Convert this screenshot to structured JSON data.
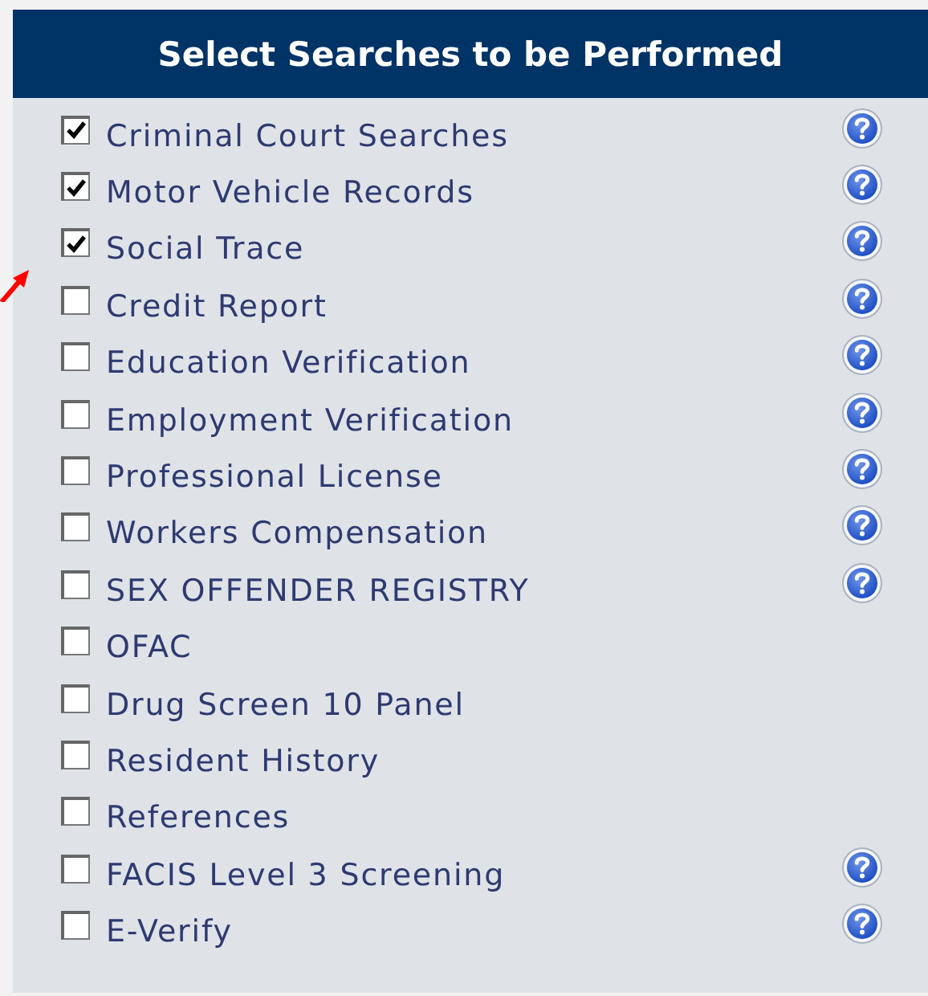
{
  "panel": {
    "title": "Select Searches to be Performed"
  },
  "searches": [
    {
      "label": "Criminal Court Searches",
      "checked": true,
      "help": true
    },
    {
      "label": "Motor Vehicle Records",
      "checked": true,
      "help": true
    },
    {
      "label": "Social Trace",
      "checked": true,
      "help": true
    },
    {
      "label": "Credit Report",
      "checked": false,
      "help": true
    },
    {
      "label": "Education Verification",
      "checked": false,
      "help": true
    },
    {
      "label": "Employment Verification",
      "checked": false,
      "help": true
    },
    {
      "label": "Professional License",
      "checked": false,
      "help": true
    },
    {
      "label": "Workers Compensation",
      "checked": false,
      "help": true
    },
    {
      "label": "SEX OFFENDER REGISTRY",
      "checked": false,
      "help": true
    },
    {
      "label": "OFAC",
      "checked": false,
      "help": false
    },
    {
      "label": "Drug Screen 10 Panel",
      "checked": false,
      "help": false
    },
    {
      "label": "Resident History",
      "checked": false,
      "help": false
    },
    {
      "label": "References",
      "checked": false,
      "help": false
    },
    {
      "label": "FACIS Level 3 Screening",
      "checked": false,
      "help": true
    },
    {
      "label": "E-Verify",
      "checked": false,
      "help": true
    }
  ]
}
